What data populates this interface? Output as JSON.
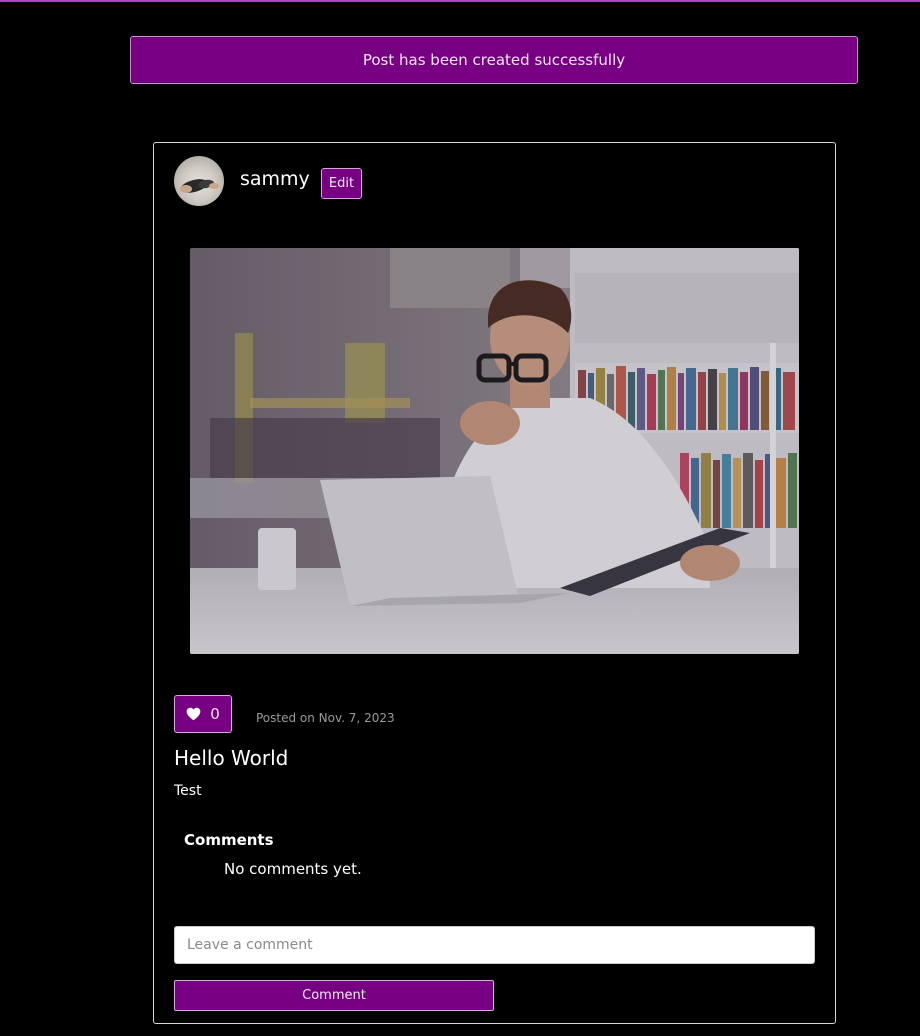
{
  "alert": {
    "message": "Post has been created successfully"
  },
  "post": {
    "author": "sammy",
    "edit_label": "Edit",
    "like_icon": "heart-icon",
    "like_count": "0",
    "posted_on": "Posted on Nov. 7, 2023",
    "title": "Hello World",
    "body": "Test",
    "image_description": "Man with glasses at laptop in office with bookshelves"
  },
  "comments": {
    "heading": "Comments",
    "empty_text": "No comments yet.",
    "input_placeholder": "Leave a comment",
    "submit_label": "Comment"
  },
  "colors": {
    "accent": "#760081",
    "background": "#000000",
    "text": "#ffffff"
  }
}
